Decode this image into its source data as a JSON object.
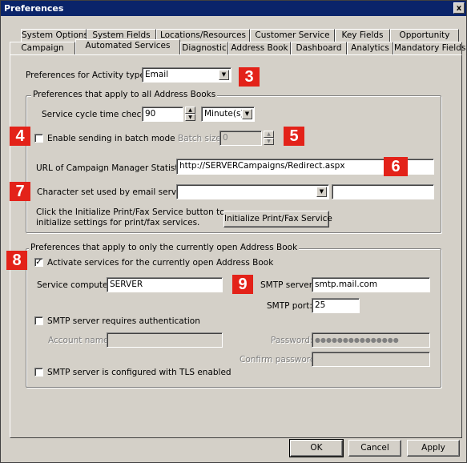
{
  "window": {
    "title": "Preferences",
    "close_glyph": "x"
  },
  "tabs": {
    "row1": [
      "System Options",
      "System Fields",
      "Locations/Resources",
      "Customer Service",
      "Key Fields",
      "Opportunity"
    ],
    "row2": [
      "Campaign",
      "Automated Services",
      "Diagnostic",
      "Address Book",
      "Dashboard",
      "Analytics",
      "Mandatory Fields"
    ],
    "active": "Automated Services"
  },
  "activity": {
    "label": "Preferences for Activity type:",
    "value": "Email"
  },
  "all_books": {
    "legend": "Preferences that apply to all Address Books",
    "cycle_label": "Service cycle time check:",
    "cycle_value": "90",
    "unit_value": "Minute(s)",
    "batch_checkbox_label": "Enable sending in batch mode",
    "batch_checked": false,
    "batch_size_label": "Batch size:",
    "batch_size_value": "0",
    "url_label": "URL of Campaign Manager Statistics:",
    "url_value": "http://SERVERCampaigns/Redirect.aspx",
    "charset_label": "Character set used by email service:",
    "charset_value": "",
    "charset_extra": "",
    "print_fax_text_1": "Click the Initialize Print/Fax Service button to",
    "print_fax_text_2": "initialize settings for print/fax services.",
    "print_fax_button": "Initialize Print/Fax Service"
  },
  "open_book": {
    "legend": "Preferences that apply to only the currently open Address Book",
    "activate_label": "Activate services for the currently open Address Book",
    "activate_checked": true,
    "computer_label": "Service computer:",
    "computer_value": "SERVER",
    "smtp_server_label": "SMTP server:",
    "smtp_server_value": "smtp.mail.com",
    "smtp_port_label": "SMTP port:",
    "smtp_port_value": "25",
    "auth_label": "SMTP server requires authentication",
    "auth_checked": false,
    "account_label": "Account name:",
    "account_value": "",
    "password_label": "Password:",
    "password_value": "●●●●●●●●●●●●●●●",
    "confirm_label": "Confirm password:",
    "confirm_value": "",
    "tls_label": "SMTP server is configured with TLS enabled",
    "tls_checked": false
  },
  "buttons": {
    "ok": "OK",
    "cancel": "Cancel",
    "apply": "Apply"
  },
  "callouts": [
    "3",
    "4",
    "5",
    "6",
    "7",
    "8",
    "9"
  ],
  "colors": {
    "callout": "#e32219",
    "titlebar": "#0a246a",
    "face": "#d4d0c8"
  }
}
